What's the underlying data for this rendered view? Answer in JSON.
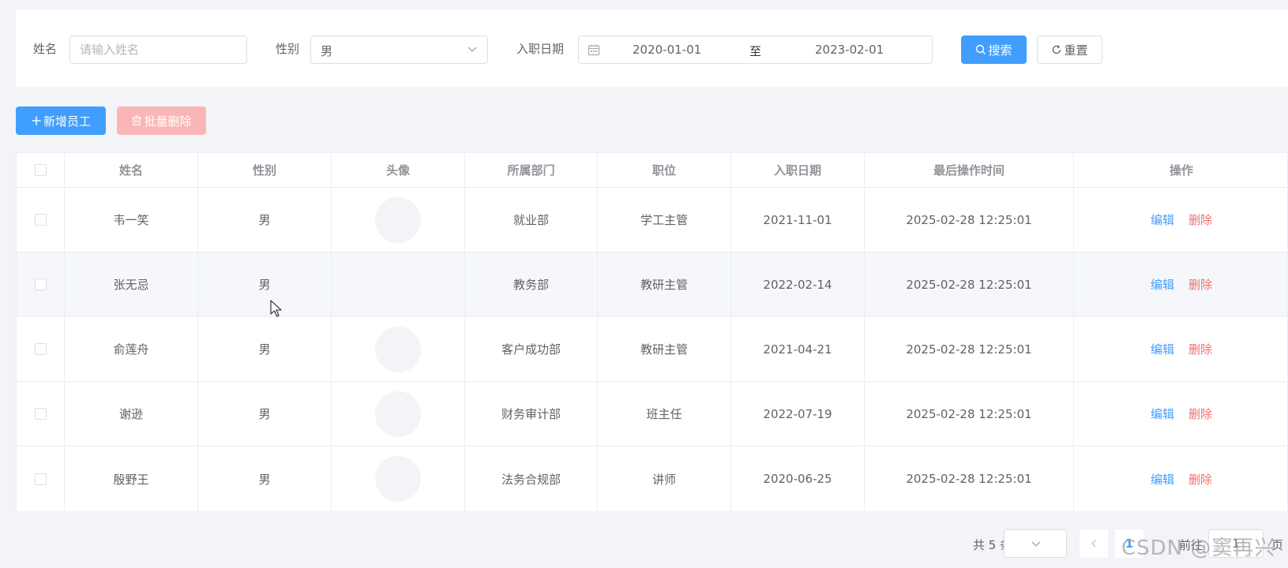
{
  "search": {
    "name_label": "姓名",
    "name_placeholder": "请输入姓名",
    "name_value": "",
    "gender_label": "性别",
    "gender_value": "男",
    "date_label": "入职日期",
    "date_start": "2020-01-01",
    "date_separator": "至",
    "date_end": "2023-02-01",
    "search_button": "搜索",
    "reset_button": "重置"
  },
  "toolbar": {
    "add_button": "新增员工",
    "batch_delete_button": "批量删除"
  },
  "table": {
    "columns": [
      "姓名",
      "性别",
      "头像",
      "所属部门",
      "职位",
      "入职日期",
      "最后操作时间",
      "操作"
    ],
    "rows": [
      {
        "name": "韦一笑",
        "gender": "男",
        "dept": "就业部",
        "job": "学工主管",
        "entry": "2021-11-01",
        "updated": "2025-02-28 12:25:01"
      },
      {
        "name": "张无忌",
        "gender": "男",
        "dept": "教务部",
        "job": "教研主管",
        "entry": "2022-02-14",
        "updated": "2025-02-28 12:25:01"
      },
      {
        "name": "俞莲舟",
        "gender": "男",
        "dept": "客户成功部",
        "job": "教研主管",
        "entry": "2021-04-21",
        "updated": "2025-02-28 12:25:01"
      },
      {
        "name": "谢逊",
        "gender": "男",
        "dept": "财务审计部",
        "job": "班主任",
        "entry": "2022-07-19",
        "updated": "2025-02-28 12:25:01"
      },
      {
        "name": "殷野王",
        "gender": "男",
        "dept": "法务合规部",
        "job": "讲师",
        "entry": "2020-06-25",
        "updated": "2025-02-28 12:25:01"
      }
    ],
    "edit_label": "编辑",
    "delete_label": "删除"
  },
  "pagination": {
    "total_text": "共 5 条",
    "current_page": "1",
    "goto_label": "前往",
    "goto_value": "1",
    "page_unit": "页"
  },
  "watermark": "CSDN @窦再兴",
  "colors": {
    "primary": "#409eff",
    "danger": "#f56c6c",
    "danger_disabled": "#fab6b6"
  }
}
